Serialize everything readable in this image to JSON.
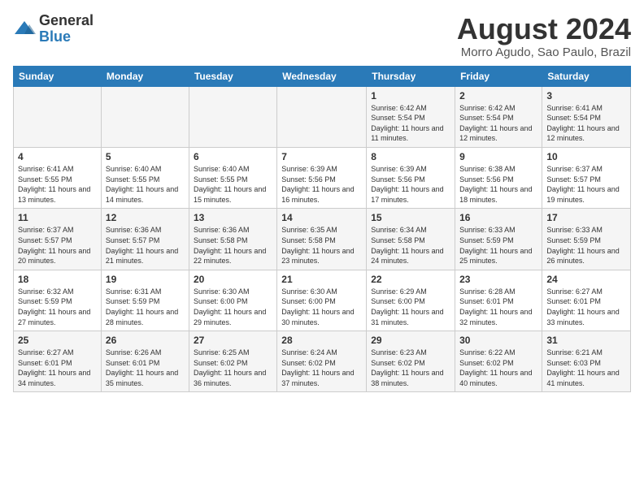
{
  "logo": {
    "general": "General",
    "blue": "Blue"
  },
  "calendar": {
    "title": "August 2024",
    "subtitle": "Morro Agudo, Sao Paulo, Brazil"
  },
  "weekdays": [
    "Sunday",
    "Monday",
    "Tuesday",
    "Wednesday",
    "Thursday",
    "Friday",
    "Saturday"
  ],
  "weeks": [
    [
      {
        "day": "",
        "info": ""
      },
      {
        "day": "",
        "info": ""
      },
      {
        "day": "",
        "info": ""
      },
      {
        "day": "",
        "info": ""
      },
      {
        "day": "1",
        "info": "Sunrise: 6:42 AM\nSunset: 5:54 PM\nDaylight: 11 hours and 11 minutes."
      },
      {
        "day": "2",
        "info": "Sunrise: 6:42 AM\nSunset: 5:54 PM\nDaylight: 11 hours and 12 minutes."
      },
      {
        "day": "3",
        "info": "Sunrise: 6:41 AM\nSunset: 5:54 PM\nDaylight: 11 hours and 12 minutes."
      }
    ],
    [
      {
        "day": "4",
        "info": "Sunrise: 6:41 AM\nSunset: 5:55 PM\nDaylight: 11 hours and 13 minutes."
      },
      {
        "day": "5",
        "info": "Sunrise: 6:40 AM\nSunset: 5:55 PM\nDaylight: 11 hours and 14 minutes."
      },
      {
        "day": "6",
        "info": "Sunrise: 6:40 AM\nSunset: 5:55 PM\nDaylight: 11 hours and 15 minutes."
      },
      {
        "day": "7",
        "info": "Sunrise: 6:39 AM\nSunset: 5:56 PM\nDaylight: 11 hours and 16 minutes."
      },
      {
        "day": "8",
        "info": "Sunrise: 6:39 AM\nSunset: 5:56 PM\nDaylight: 11 hours and 17 minutes."
      },
      {
        "day": "9",
        "info": "Sunrise: 6:38 AM\nSunset: 5:56 PM\nDaylight: 11 hours and 18 minutes."
      },
      {
        "day": "10",
        "info": "Sunrise: 6:37 AM\nSunset: 5:57 PM\nDaylight: 11 hours and 19 minutes."
      }
    ],
    [
      {
        "day": "11",
        "info": "Sunrise: 6:37 AM\nSunset: 5:57 PM\nDaylight: 11 hours and 20 minutes."
      },
      {
        "day": "12",
        "info": "Sunrise: 6:36 AM\nSunset: 5:57 PM\nDaylight: 11 hours and 21 minutes."
      },
      {
        "day": "13",
        "info": "Sunrise: 6:36 AM\nSunset: 5:58 PM\nDaylight: 11 hours and 22 minutes."
      },
      {
        "day": "14",
        "info": "Sunrise: 6:35 AM\nSunset: 5:58 PM\nDaylight: 11 hours and 23 minutes."
      },
      {
        "day": "15",
        "info": "Sunrise: 6:34 AM\nSunset: 5:58 PM\nDaylight: 11 hours and 24 minutes."
      },
      {
        "day": "16",
        "info": "Sunrise: 6:33 AM\nSunset: 5:59 PM\nDaylight: 11 hours and 25 minutes."
      },
      {
        "day": "17",
        "info": "Sunrise: 6:33 AM\nSunset: 5:59 PM\nDaylight: 11 hours and 26 minutes."
      }
    ],
    [
      {
        "day": "18",
        "info": "Sunrise: 6:32 AM\nSunset: 5:59 PM\nDaylight: 11 hours and 27 minutes."
      },
      {
        "day": "19",
        "info": "Sunrise: 6:31 AM\nSunset: 5:59 PM\nDaylight: 11 hours and 28 minutes."
      },
      {
        "day": "20",
        "info": "Sunrise: 6:30 AM\nSunset: 6:00 PM\nDaylight: 11 hours and 29 minutes."
      },
      {
        "day": "21",
        "info": "Sunrise: 6:30 AM\nSunset: 6:00 PM\nDaylight: 11 hours and 30 minutes."
      },
      {
        "day": "22",
        "info": "Sunrise: 6:29 AM\nSunset: 6:00 PM\nDaylight: 11 hours and 31 minutes."
      },
      {
        "day": "23",
        "info": "Sunrise: 6:28 AM\nSunset: 6:01 PM\nDaylight: 11 hours and 32 minutes."
      },
      {
        "day": "24",
        "info": "Sunrise: 6:27 AM\nSunset: 6:01 PM\nDaylight: 11 hours and 33 minutes."
      }
    ],
    [
      {
        "day": "25",
        "info": "Sunrise: 6:27 AM\nSunset: 6:01 PM\nDaylight: 11 hours and 34 minutes."
      },
      {
        "day": "26",
        "info": "Sunrise: 6:26 AM\nSunset: 6:01 PM\nDaylight: 11 hours and 35 minutes."
      },
      {
        "day": "27",
        "info": "Sunrise: 6:25 AM\nSunset: 6:02 PM\nDaylight: 11 hours and 36 minutes."
      },
      {
        "day": "28",
        "info": "Sunrise: 6:24 AM\nSunset: 6:02 PM\nDaylight: 11 hours and 37 minutes."
      },
      {
        "day": "29",
        "info": "Sunrise: 6:23 AM\nSunset: 6:02 PM\nDaylight: 11 hours and 38 minutes."
      },
      {
        "day": "30",
        "info": "Sunrise: 6:22 AM\nSunset: 6:02 PM\nDaylight: 11 hours and 40 minutes."
      },
      {
        "day": "31",
        "info": "Sunrise: 6:21 AM\nSunset: 6:03 PM\nDaylight: 11 hours and 41 minutes."
      }
    ]
  ]
}
